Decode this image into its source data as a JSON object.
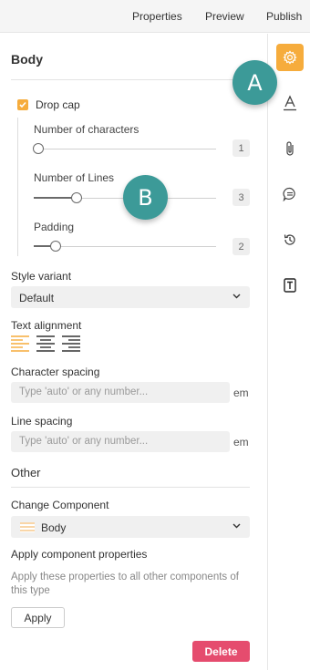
{
  "topbar": {
    "tabs": [
      "Properties",
      "Preview",
      "Publish"
    ]
  },
  "rail": {
    "icons": [
      "gear-icon",
      "text-style-icon",
      "attachment-icon",
      "comment-icon",
      "history-icon",
      "text-box-icon"
    ],
    "active_index": 0,
    "accent": "#f6ac3c"
  },
  "panel": {
    "heading": "Body",
    "drop_cap": {
      "label": "Drop cap",
      "checked": true,
      "sliders": [
        {
          "label": "Number of characters",
          "value": "1",
          "level": 0
        },
        {
          "label": "Number of Lines",
          "value": "3",
          "level": 0.24
        },
        {
          "label": "Padding",
          "value": "2",
          "level": 0.12
        }
      ]
    },
    "style_variant": {
      "label": "Style variant",
      "value": "Default"
    },
    "text_alignment": {
      "label": "Text alignment",
      "options": [
        "align-left-icon",
        "align-center-icon",
        "align-justify-icon"
      ],
      "selected_index": 0
    },
    "character_spacing": {
      "label": "Character spacing",
      "placeholder": "Type 'auto' or any number...",
      "unit": "em"
    },
    "line_spacing": {
      "label": "Line spacing",
      "placeholder": "Type 'auto' or any number...",
      "unit": "em"
    },
    "other": {
      "label": "Other"
    },
    "change_component": {
      "label": "Change Component",
      "value": "Body"
    },
    "apply_props": {
      "label": "Apply component properties",
      "help": "Apply these properties to all other components of this type",
      "button": "Apply"
    },
    "delete_button": "Delete",
    "delete_color": "#e54c6e"
  },
  "callouts": [
    "A",
    "B"
  ],
  "callout_color": "#3c9a98"
}
